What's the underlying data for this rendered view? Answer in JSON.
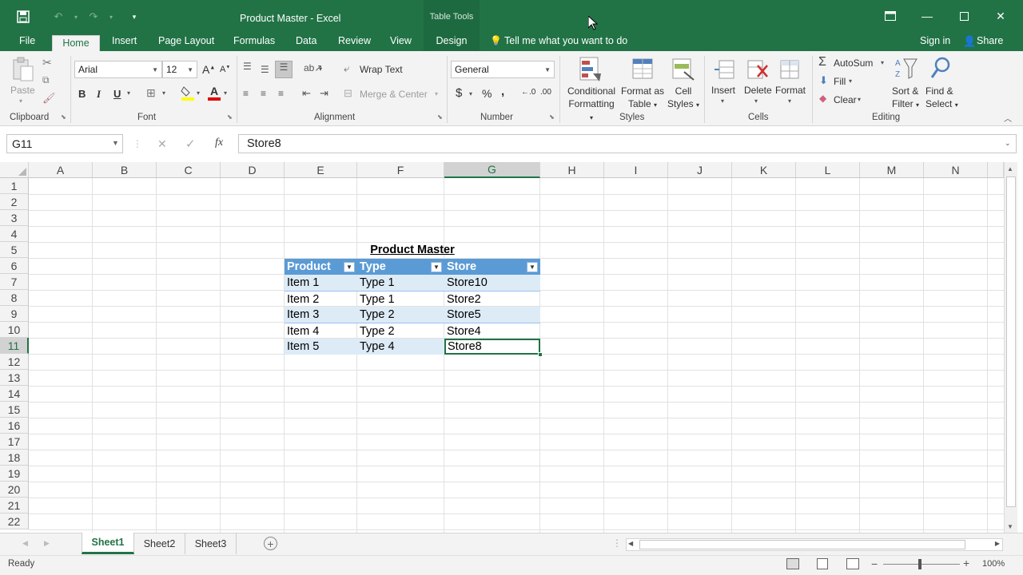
{
  "title_bar": {
    "app_title": "Product Master - Excel",
    "context_tab_group": "Table Tools",
    "qat": {
      "save_icon": "save-icon",
      "undo_icon": "undo-icon",
      "redo_icon": "redo-icon",
      "customize_icon": "customize-qat-icon"
    }
  },
  "menu_tabs": [
    "File",
    "Home",
    "Insert",
    "Page Layout",
    "Formulas",
    "Data",
    "Review",
    "View",
    "Design"
  ],
  "tell_me": "Tell me what you want to do",
  "sign_in": "Sign in",
  "share": "Share",
  "ribbon": {
    "clipboard": {
      "label": "Clipboard",
      "paste": "Paste"
    },
    "font": {
      "label": "Font",
      "name": "Arial",
      "size": "12",
      "bold": "B",
      "italic": "I",
      "underline": "U",
      "grow": "A",
      "shrink": "A",
      "font_color_letter": "A"
    },
    "alignment": {
      "label": "Alignment",
      "wrap_text": "Wrap Text",
      "merge_center": "Merge & Center"
    },
    "number": {
      "label": "Number",
      "format": "General",
      "currency": "$",
      "percent": "%",
      "comma": ",",
      "inc_dec": "←.0",
      "dec_dec": ".00"
    },
    "styles": {
      "label": "Styles",
      "conditional": [
        "Conditional",
        "Formatting"
      ],
      "format_table": [
        "Format as",
        "Table"
      ],
      "cell_styles": [
        "Cell",
        "Styles"
      ]
    },
    "cells": {
      "label": "Cells",
      "insert": "Insert",
      "delete": "Delete",
      "format": "Format"
    },
    "editing": {
      "label": "Editing",
      "autosum": "AutoSum",
      "fill": "Fill",
      "clear": "Clear",
      "sort_filter": [
        "Sort &",
        "Filter"
      ],
      "find_select": [
        "Find &",
        "Select"
      ]
    }
  },
  "formula_bar": {
    "name_box": "G11",
    "cancel": "✕",
    "enter": "✓",
    "fx": "fx",
    "value": "Store8"
  },
  "columns": [
    "A",
    "B",
    "C",
    "D",
    "E",
    "F",
    "G",
    "H",
    "I",
    "J",
    "K",
    "L",
    "M",
    "N"
  ],
  "rows": [
    "1",
    "2",
    "3",
    "4",
    "5",
    "6",
    "7",
    "8",
    "9",
    "10",
    "11",
    "12",
    "13",
    "14",
    "15",
    "16",
    "17",
    "18",
    "19",
    "20",
    "21",
    "22"
  ],
  "sheet_title": "Product Master",
  "table": {
    "headers": [
      "Product",
      "Type",
      "Store"
    ],
    "rows": [
      [
        "Item 1",
        "Type 1",
        "Store10"
      ],
      [
        "Item 2",
        "Type 1",
        "Store2"
      ],
      [
        "Item 3",
        "Type 2",
        "Store5"
      ],
      [
        "Item 4",
        "Type 2",
        "Store4"
      ],
      [
        "Item 5",
        "Type 4",
        "Store8"
      ]
    ]
  },
  "sheets": [
    "Sheet1",
    "Sheet2",
    "Sheet3"
  ],
  "status": {
    "ready": "Ready",
    "zoom": "100%",
    "zoom_minus": "−",
    "zoom_plus": "+"
  },
  "colors": {
    "excel_green": "#217346",
    "table_header": "#5b9bd5",
    "table_band": "#ddebf7"
  }
}
